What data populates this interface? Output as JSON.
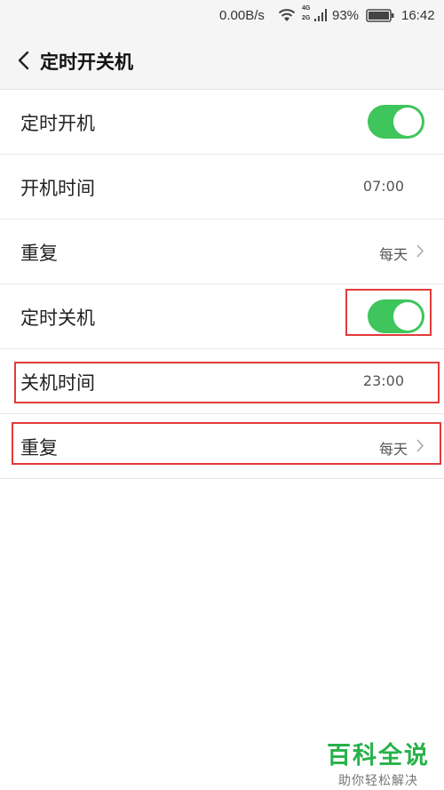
{
  "status_bar": {
    "network_speed": "0.00B/s",
    "signal_4g": "4G",
    "signal_2g": "2G",
    "battery_percent": "93%",
    "time": "16:42",
    "icons": [
      "wifi-icon",
      "signal-icon",
      "battery-icon"
    ]
  },
  "header": {
    "back_icon": "chevron-left-icon",
    "title": "定时开关机"
  },
  "rows": [
    {
      "label": "定时开机",
      "type": "toggle",
      "on": true
    },
    {
      "label": "开机时间",
      "type": "value",
      "value": "07:00"
    },
    {
      "label": "重复",
      "type": "nav",
      "value": "每天"
    },
    {
      "label": "定时关机",
      "type": "toggle",
      "on": true
    },
    {
      "label": "关机时间",
      "type": "value",
      "value": "23:00"
    },
    {
      "label": "重复",
      "type": "nav",
      "value": "每天"
    }
  ],
  "colors": {
    "toggle_on": "#3ec55b",
    "highlight": "#e23a3a",
    "watermark": "#27b24a"
  },
  "watermark": {
    "title": "百科全说",
    "subtitle": "助你轻松解决"
  }
}
